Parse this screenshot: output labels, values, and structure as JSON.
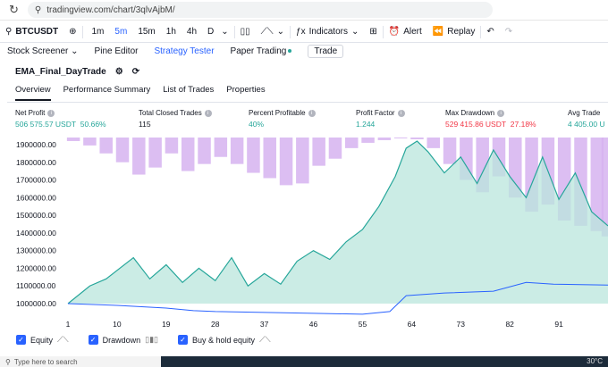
{
  "browser": {
    "url": "tradingview.com/chart/3qlvAjbM/"
  },
  "toolbar": {
    "symbol": "BTCUSDT",
    "intervals": [
      "1m",
      "5m",
      "15m",
      "1h",
      "4h",
      "D"
    ],
    "indicators_label": "Indicators",
    "alert_label": "Alert",
    "replay_label": "Replay"
  },
  "panel_tabs": {
    "stock_screener": "Stock Screener",
    "pine_editor": "Pine Editor",
    "strategy_tester": "Strategy Tester",
    "paper_trading": "Paper Trading",
    "trade": "Trade"
  },
  "strategy": {
    "name": "EMA_Final_DayTrade",
    "tabs": [
      "Overview",
      "Performance Summary",
      "List of Trades",
      "Properties"
    ]
  },
  "metrics": {
    "net_profit": {
      "label": "Net Profit",
      "value": "506 575.57 USDT",
      "pct": "50.66%"
    },
    "closed_trades": {
      "label": "Total Closed Trades",
      "value": "115"
    },
    "percent_profitable": {
      "label": "Percent Profitable",
      "value": "40%"
    },
    "profit_factor": {
      "label": "Profit Factor",
      "value": "1.244"
    },
    "max_drawdown": {
      "label": "Max Drawdown",
      "value": "529 415.86 USDT",
      "pct": "27.18%"
    },
    "avg_trade": {
      "label": "Avg Trade",
      "value": "4 405.00 U"
    }
  },
  "legend": {
    "equity": "Equity",
    "drawdown": "Drawdown",
    "buy_hold": "Buy & hold equity"
  },
  "taskbar": {
    "search_placeholder": "Type here to search",
    "temperature": "30°C"
  },
  "colors": {
    "accent": "#2962ff",
    "equity_fill": "#b9e6dc",
    "equity_line": "#26a69a",
    "drawdown": "#d6b3f0",
    "buy_hold": "#2962ff",
    "negative": "#f23645"
  },
  "chart_data": {
    "type": "area",
    "y_ticks": [
      "1900000.00",
      "1800000.00",
      "1700000.00",
      "1600000.00",
      "1500000.00",
      "1400000.00",
      "1300000.00",
      "1200000.00",
      "1100000.00",
      "1000000.00"
    ],
    "x_ticks": [
      "1",
      "10",
      "19",
      "28",
      "37",
      "46",
      "55",
      "64",
      "73",
      "82",
      "91"
    ],
    "ylim": [
      1000000,
      1900000
    ],
    "xlim": [
      1,
      100
    ],
    "series": [
      {
        "name": "Equity",
        "x": [
          1,
          5,
          8,
          13,
          16,
          19,
          22,
          25,
          28,
          31,
          34,
          37,
          40,
          43,
          46,
          49,
          52,
          55,
          58,
          61,
          63,
          65,
          67,
          70,
          73,
          76,
          79,
          82,
          85,
          88,
          91,
          94,
          97,
          100
        ],
        "values": [
          1000000,
          1100000,
          1140000,
          1260000,
          1140000,
          1220000,
          1120000,
          1200000,
          1130000,
          1260000,
          1100000,
          1170000,
          1110000,
          1240000,
          1300000,
          1250000,
          1350000,
          1420000,
          1550000,
          1720000,
          1880000,
          1920000,
          1860000,
          1740000,
          1830000,
          1680000,
          1870000,
          1720000,
          1600000,
          1830000,
          1590000,
          1740000,
          1520000,
          1440000
        ]
      },
      {
        "name": "Buy & hold equity",
        "x": [
          1,
          10,
          19,
          24,
          28,
          37,
          46,
          55,
          60,
          63,
          70,
          79,
          85,
          90,
          100
        ],
        "values": [
          1000000,
          990000,
          975000,
          960000,
          955000,
          950000,
          945000,
          940000,
          955000,
          1045000,
          1060000,
          1070000,
          1120000,
          1110000,
          1105000
        ]
      }
    ],
    "drawdown": {
      "name": "Drawdown",
      "x": [
        2,
        5,
        8,
        11,
        14,
        17,
        20,
        23,
        26,
        29,
        32,
        35,
        38,
        41,
        44,
        47,
        50,
        53,
        56,
        59,
        62,
        65,
        68,
        71,
        74,
        77,
        80,
        83,
        86,
        89,
        92,
        95,
        98,
        100
      ],
      "values": [
        20000,
        45000,
        90000,
        140000,
        210000,
        170000,
        90000,
        190000,
        150000,
        110000,
        150000,
        200000,
        230000,
        270000,
        260000,
        160000,
        120000,
        60000,
        30000,
        15000,
        5000,
        10000,
        60000,
        150000,
        240000,
        310000,
        220000,
        340000,
        420000,
        380000,
        470000,
        500000,
        530000,
        560000
      ]
    }
  }
}
